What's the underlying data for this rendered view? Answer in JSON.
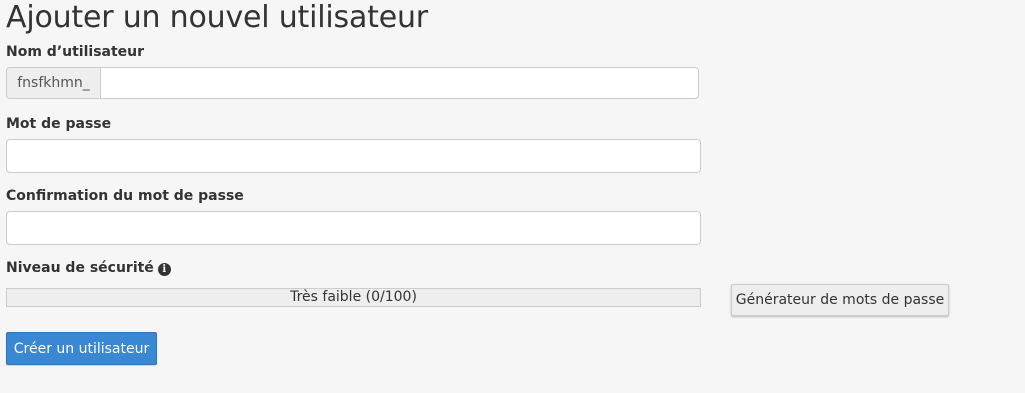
{
  "page": {
    "title": "Ajouter un nouvel utilisateur"
  },
  "username": {
    "label": "Nom d’utilisateur",
    "prefix": "fnsfkhmn_",
    "value": ""
  },
  "password": {
    "label": "Mot de passe",
    "value": ""
  },
  "password_confirm": {
    "label": "Confirmation du mot de passe",
    "value": ""
  },
  "strength": {
    "label": "Niveau de sécurité",
    "info_icon": "info-circle-icon",
    "text": "Très faible (0/100)",
    "score": 0,
    "max": 100
  },
  "buttons": {
    "generator": "Générateur de mots de passe",
    "create": "Créer un utilisateur"
  },
  "colors": {
    "primary": "#3a87d3",
    "background": "#f6f6f6"
  }
}
